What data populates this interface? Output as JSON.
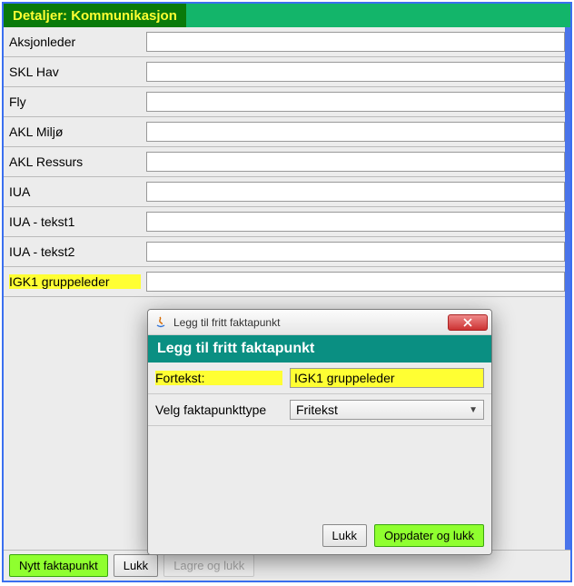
{
  "header": {
    "title": "Detaljer: Kommunikasjon"
  },
  "fields": [
    {
      "label": "Aksjonleder",
      "value": "",
      "highlight": false
    },
    {
      "label": "SKL Hav",
      "value": "",
      "highlight": false
    },
    {
      "label": "Fly",
      "value": "",
      "highlight": false
    },
    {
      "label": "AKL Miljø",
      "value": "",
      "highlight": false
    },
    {
      "label": "AKL Ressurs",
      "value": "",
      "highlight": false
    },
    {
      "label": "IUA",
      "value": "",
      "highlight": false
    },
    {
      "label": "IUA - tekst1",
      "value": "",
      "highlight": false
    },
    {
      "label": "IUA - tekst2",
      "value": "",
      "highlight": false
    },
    {
      "label": "IGK1 gruppeleder",
      "value": "",
      "highlight": true
    }
  ],
  "bottom": {
    "new": "Nytt faktapunkt",
    "close": "Lukk",
    "save_close": "Lagre og lukk"
  },
  "dialog": {
    "window_title": "Legg til fritt faktapunkt",
    "heading": "Legg til fritt faktapunkt",
    "row1_label": "Fortekst:",
    "row1_value": "IGK1 gruppeleder",
    "row2_label": "Velg faktapunkttype",
    "row2_value": "Fritekst",
    "btn_close": "Lukk",
    "btn_update": "Oppdater og lukk"
  }
}
